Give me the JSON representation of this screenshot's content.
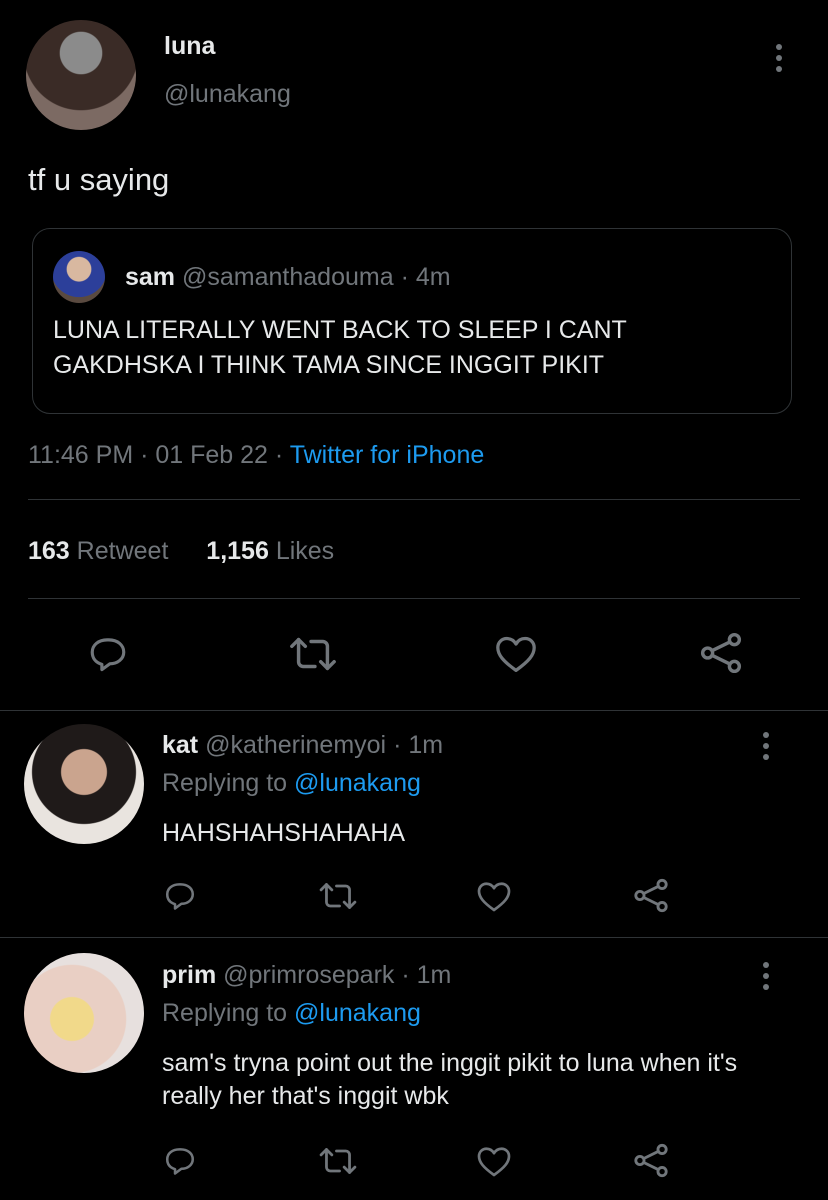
{
  "main_tweet": {
    "author_name": "luna",
    "author_handle": "@lunakang",
    "text": "tf u saying",
    "quoted": {
      "author_name": "sam",
      "author_handle": "@samanthadouma",
      "time": "· 4m",
      "text": "LUNA LITERALLY WENT BACK TO SLEEP I CANT GAKDHSKA I THINK TAMA SINCE INGGIT PIKIT"
    },
    "timestamp": "11:46 PM · 01 Feb 22 · ",
    "source": "Twitter for iPhone",
    "retweet_count": "163",
    "retweet_label": "Retweet",
    "like_count": "1,156",
    "like_label": "Likes"
  },
  "replies": [
    {
      "author_name": "kat",
      "author_handle": "@katherinemyoi",
      "time": "· 1m",
      "replying_prefix": "Replying to ",
      "replying_to": "@lunakang",
      "text": "HAHSHAHSHAHAHA"
    },
    {
      "author_name": "prim",
      "author_handle": "@primrosepark",
      "time": "· 1m",
      "replying_prefix": "Replying to ",
      "replying_to": "@lunakang",
      "text": "sam's tryna point out the inggit pikit to luna when it's really her that's inggit wbk"
    }
  ],
  "icons": [
    "reply-icon",
    "retweet-icon",
    "like-icon",
    "share-icon",
    "more-icon"
  ],
  "colors": {
    "background": "#000000",
    "text": "#e7e9ea",
    "secondary": "#71767b",
    "accent": "#1d9bf0",
    "divider": "#2f3336"
  }
}
